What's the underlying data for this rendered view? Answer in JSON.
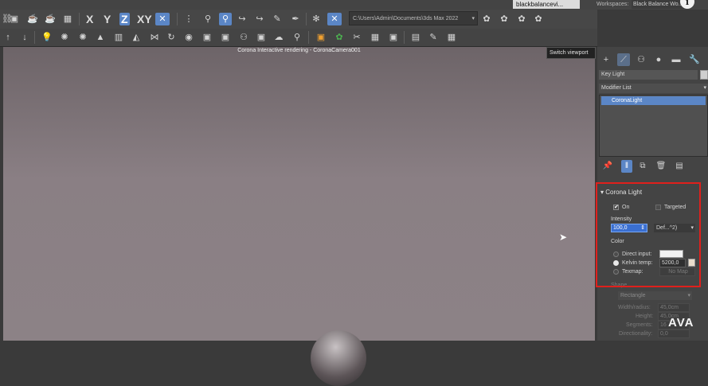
{
  "top_bar": {
    "user_label": "blackbalancevi...",
    "workspaces_label": "Workspaces:",
    "workspace_value": "Black Balance Wo...",
    "info_icon": "i"
  },
  "toolbar": {
    "axes": [
      "X",
      "Y",
      "Z",
      "XY"
    ],
    "active_axis": "Z",
    "path": "C:\\Users\\Admin\\Documents\\3ds Max 2022",
    "path_arrow": "▾"
  },
  "viewport": {
    "title": "Corona Interactive rendering - CoronaCamera001",
    "tooltip": "Switch viewport"
  },
  "command_panel": {
    "object_name": "Key Light",
    "modifier_list_label": "Modifier List",
    "modifier_stack_items": [
      "CoronaLight"
    ],
    "rollout_title": "Corona Light",
    "on_label": "On",
    "on_checked": "✔",
    "targeted_label": "Targeted",
    "intensity_label": "Intensity",
    "intensity_value": "100,0",
    "intensity_unit": "Def...^2)",
    "color_label": "Color",
    "direct_input_label": "Direct input:",
    "kelvin_label": "Kelvin temp:",
    "kelvin_value": "5200,0",
    "texmap_label": "Texmap:",
    "texmap_value": "No Map",
    "shape_label": "Shape",
    "shape_value": "Rectangle",
    "width_label": "Width/radius:",
    "width_value": "45,0cm",
    "height_label": "Height:",
    "height_value": "45,0cm",
    "segments_label": "Segments:",
    "segments_value": "16",
    "directionality_label": "Directionality:",
    "directionality_value": "0,0"
  },
  "watermark": "AVA",
  "colors": {
    "accent": "#5b86c6",
    "highlight_box": "#e0201c",
    "viewport_bg": "#8a7f84"
  }
}
